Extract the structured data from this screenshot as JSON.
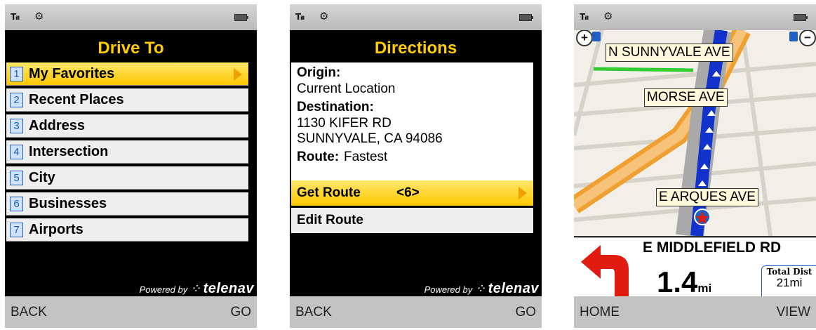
{
  "status": {
    "signal": "Tᵢₗₗ",
    "gear_icon": "gear-icon",
    "battery_icon": "battery-icon"
  },
  "screen1": {
    "title": "Drive To",
    "items": [
      {
        "num": "1",
        "label": "My Favorites"
      },
      {
        "num": "2",
        "label": "Recent Places"
      },
      {
        "num": "3",
        "label": "Address"
      },
      {
        "num": "4",
        "label": "Intersection"
      },
      {
        "num": "5",
        "label": "City"
      },
      {
        "num": "6",
        "label": "Businesses"
      },
      {
        "num": "7",
        "label": "Airports"
      }
    ],
    "powered_by": "Powered by",
    "brand": "telenav",
    "soft_left": "BACK",
    "soft_right": "GO"
  },
  "screen2": {
    "title": "Directions",
    "origin_label": "Origin:",
    "origin_value": "Current Location",
    "destination_label": "Destination:",
    "destination_line1": "1130 KIFER RD",
    "destination_line2": "SUNNYVALE, CA 94086",
    "route_label": "Route:",
    "route_value": "Fastest",
    "get_route": "Get Route",
    "get_route_count": "<6>",
    "edit_route": "Edit Route",
    "powered_by": "Powered by",
    "brand": "telenav",
    "soft_left": "BACK",
    "soft_right": "GO"
  },
  "screen3": {
    "zoom_in": "+",
    "zoom_out": "−",
    "streets": [
      "N SUNNYVALE AVE",
      "MORSE AVE",
      "E ARQUES AVE"
    ],
    "next_street": "E MIDDLEFIELD RD",
    "distance": "1.4",
    "distance_unit": "mi",
    "total_dist_label": "Total Dist",
    "total_dist_value": "21mi",
    "soft_left": "HOME",
    "soft_right": "VIEW",
    "colors": {
      "route": "#1133cc",
      "turn_arrow": "#e21b10",
      "highlight": "#33cc33"
    }
  },
  "colors": {
    "title_yellow": "#ffcc00",
    "selected_bg": "#ffd21e",
    "softkey_bg": "#c3c3c3"
  }
}
